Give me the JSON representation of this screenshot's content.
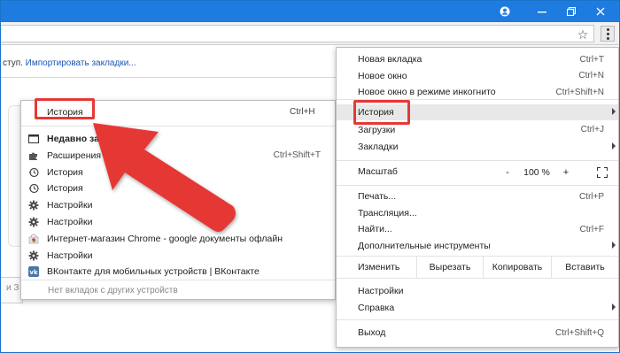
{
  "titlebar": {
    "buttons": [
      {
        "name": "account-icon"
      },
      {
        "name": "minimize-icon"
      },
      {
        "name": "restore-icon"
      },
      {
        "name": "close-icon"
      }
    ]
  },
  "toolbar": {
    "star_icon": "star-icon",
    "menu_icon": "kebab-menu-icon"
  },
  "bookmarks_bar": {
    "prefix": "ступ.",
    "link": "Импортировать закладки..."
  },
  "page": {
    "left_tab_text": "и З"
  },
  "history_submenu": {
    "header_label": "История",
    "header_shortcut": "Ctrl+H",
    "items": [
      {
        "icon": "folder-icon",
        "label": "Недавно закр",
        "shortcut": "",
        "bold": true
      },
      {
        "icon": "puzzle-icon",
        "label": "Расширения",
        "shortcut": "Ctrl+Shift+T"
      },
      {
        "icon": "history-icon",
        "label": "История",
        "shortcut": ""
      },
      {
        "icon": "history-icon",
        "label": "История",
        "shortcut": ""
      },
      {
        "icon": "gear-icon",
        "label": "Настройки",
        "shortcut": ""
      },
      {
        "icon": "gear-icon",
        "label": "Настройки",
        "shortcut": ""
      },
      {
        "icon": "chrome-store-icon",
        "label": "Интернет-магазин Chrome - google документы офлайн",
        "shortcut": ""
      },
      {
        "icon": "gear-icon",
        "label": "Настройки",
        "shortcut": ""
      },
      {
        "icon": "vk-icon",
        "label": "ВКонтакте для мобильных устройств | ВКонтакте",
        "shortcut": ""
      }
    ],
    "no_tabs": "Нет вкладок с других устройств"
  },
  "main_menu": {
    "group1": [
      {
        "label": "Новая вкладка",
        "shortcut": "Ctrl+T"
      },
      {
        "label": "Новое окно",
        "shortcut": "Ctrl+N"
      },
      {
        "label": "Новое окно в режиме инкогнито",
        "shortcut": "Ctrl+Shift+N"
      }
    ],
    "group2": [
      {
        "label": "История",
        "shortcut": "",
        "submenu": true
      },
      {
        "label": "Загрузки",
        "shortcut": "Ctrl+J"
      },
      {
        "label": "Закладки",
        "shortcut": "",
        "submenu": true
      }
    ],
    "zoom": {
      "label": "Масштаб",
      "minus": "-",
      "value": "100 %",
      "plus": "+"
    },
    "group3": [
      {
        "label": "Печать...",
        "shortcut": "Ctrl+P"
      },
      {
        "label": "Трансляция...",
        "shortcut": ""
      },
      {
        "label": "Найти...",
        "shortcut": "Ctrl+F"
      },
      {
        "label": "Дополнительные инструменты",
        "shortcut": "",
        "submenu": true
      }
    ],
    "edit": {
      "label": "Изменить",
      "cut": "Вырезать",
      "copy": "Копировать",
      "paste": "Вставить"
    },
    "group4": [
      {
        "label": "Настройки",
        "shortcut": ""
      },
      {
        "label": "Справка",
        "shortcut": "",
        "submenu": true
      }
    ],
    "exit": {
      "label": "Выход",
      "shortcut": "Ctrl+Shift+Q"
    }
  },
  "colors": {
    "titlebar": "#1e7be0",
    "highlight_box": "#e53935",
    "arrow": "#e53935"
  }
}
